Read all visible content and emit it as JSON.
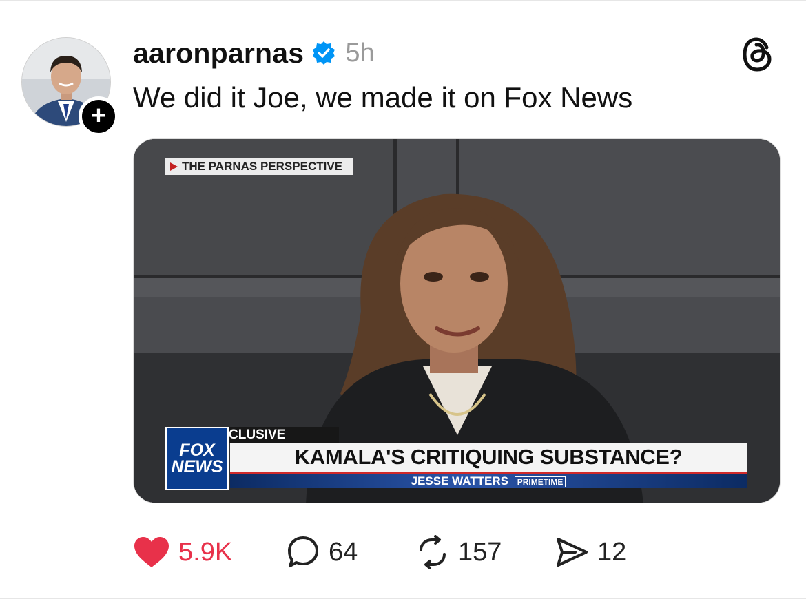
{
  "post": {
    "username": "aaronparnas",
    "time_ago": "5h",
    "text": "We did it Joe, we made it on Fox News",
    "follow_symbol": "+"
  },
  "media": {
    "tag_overlay": "THE PARNAS PERSPECTIVE",
    "network_logo_line1": "FOX",
    "network_logo_line2": "NEWS",
    "exclusive_label": "CLUSIVE",
    "chyron_headline": "KAMALA'S CRITIQUING SUBSTANCE?",
    "show_name": "JESSE WATTERS",
    "show_tag": "PRIMETIME"
  },
  "actions": {
    "likes": "5.9K",
    "replies": "64",
    "reposts": "157",
    "shares": "12"
  },
  "icons": {
    "verified": "verified-badge-icon",
    "threads": "threads-logo-icon",
    "like": "heart-icon",
    "reply": "comment-icon",
    "repost": "repost-icon",
    "share": "send-icon"
  },
  "colors": {
    "like_red": "#e8314a",
    "verified_blue": "#0095f6",
    "time_gray": "#9a9a9a"
  }
}
